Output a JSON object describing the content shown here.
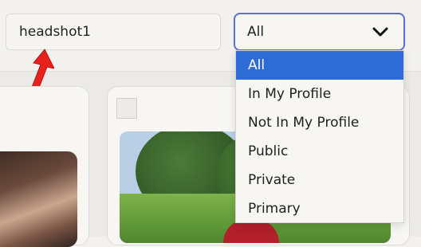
{
  "search": {
    "value": "headshot1"
  },
  "filter": {
    "selected": "All",
    "options": [
      "All",
      "In My Profile",
      "Not In My Profile",
      "Public",
      "Private",
      "Primary"
    ]
  },
  "colors": {
    "accent": "#2f6bd6",
    "focus_border": "#5a6fd6",
    "annotation_arrow": "#e8211c"
  },
  "icons": {
    "dropdown": "chevron-down-icon",
    "annotation": "red-arrow"
  }
}
